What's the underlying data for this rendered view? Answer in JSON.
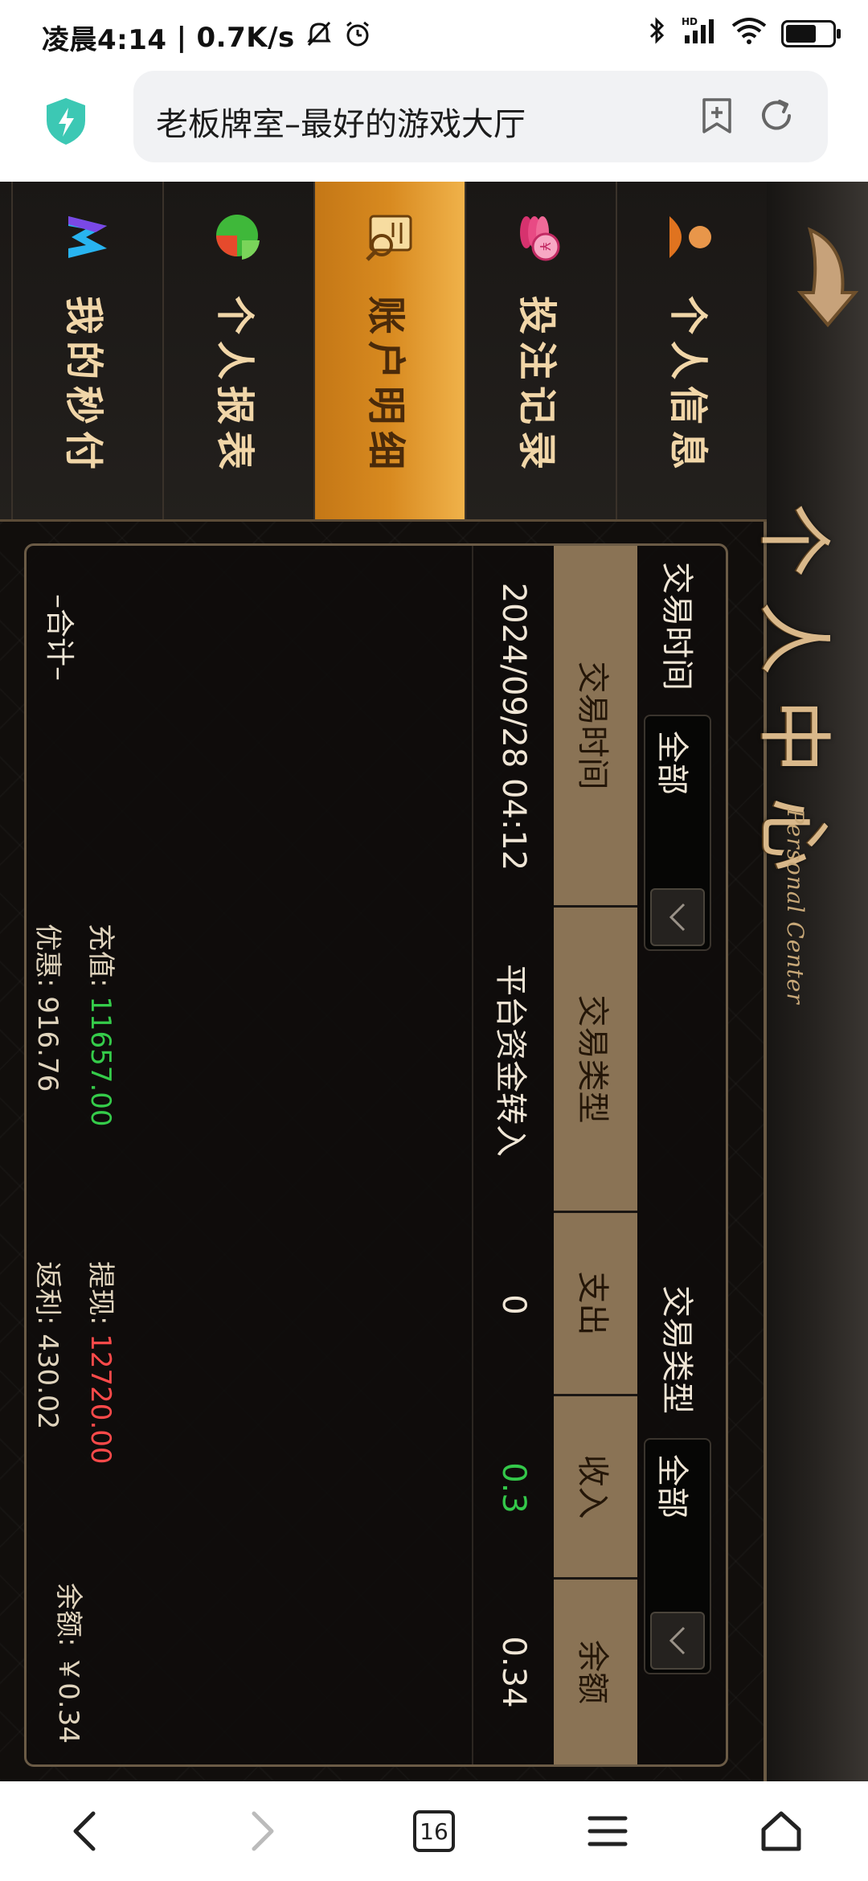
{
  "status_bar": {
    "time": "凌晨4:14",
    "speed": "0.7K/s",
    "network_label": "HD",
    "icons": [
      "mute-icon",
      "alarm-icon",
      "bluetooth-icon",
      "signal-icon",
      "wifi-icon",
      "battery-icon"
    ]
  },
  "browser": {
    "url_title": "老板牌室–最好的游戏大厅",
    "tab_count": "16"
  },
  "header": {
    "title": "个人中心",
    "subtitle": "Personal Center"
  },
  "tabs": [
    {
      "label": "个人信息",
      "icon": "person-icon",
      "active": false
    },
    {
      "label": "投注记录",
      "icon": "coins-icon",
      "active": false
    },
    {
      "label": "账户明细",
      "icon": "ledger-icon",
      "active": true
    },
    {
      "label": "个人报表",
      "icon": "pie-chart-icon",
      "active": false
    },
    {
      "label": "我的秒付",
      "icon": "m-logo-icon",
      "active": false
    }
  ],
  "filters": {
    "time_label": "交易时间",
    "time_value": "全部",
    "type_label": "交易类型",
    "type_value": "全部"
  },
  "table": {
    "headers": [
      "交易时间",
      "交易类型",
      "支出",
      "收入",
      "余额"
    ],
    "rows": [
      [
        "2024/09/28 04:12",
        "平台资金转入",
        "0",
        "0.3",
        "0.34"
      ]
    ]
  },
  "summary": {
    "label": "–合计–",
    "recharge_label": "充值:",
    "recharge_value": "11657.00",
    "withdraw_label": "提现:",
    "withdraw_value": "12720.00",
    "balance_label": "余额:",
    "balance_value": "￥0.34",
    "discount_label": "优惠:",
    "discount_value": "916.76",
    "rebate_label": "返利:",
    "rebate_value": "430.02"
  },
  "colors": {
    "accent_gold": "#d88a20",
    "income_green": "#34c84a",
    "withdraw_red": "#ff4a4a"
  }
}
